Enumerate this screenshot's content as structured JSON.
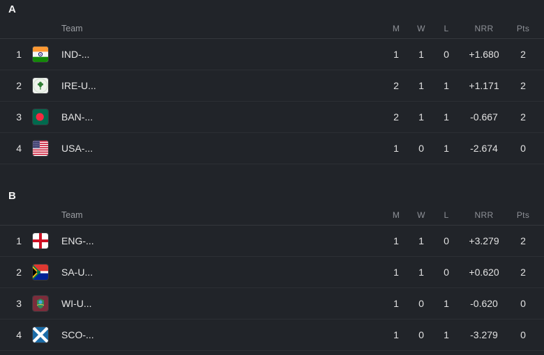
{
  "columns": {
    "team": "Team",
    "matches": "M",
    "wins": "W",
    "losses": "L",
    "nrr": "NRR",
    "points": "Pts"
  },
  "groups": [
    {
      "title": "A",
      "rows": [
        {
          "rank": "1",
          "flag": "india-flag-icon",
          "team": "IND-...",
          "m": "1",
          "w": "1",
          "l": "0",
          "nrr": "+1.680",
          "pts": "2"
        },
        {
          "rank": "2",
          "flag": "ireland-flag-icon",
          "team": "IRE-U...",
          "m": "2",
          "w": "1",
          "l": "1",
          "nrr": "+1.171",
          "pts": "2"
        },
        {
          "rank": "3",
          "flag": "bangladesh-flag-icon",
          "team": "BAN-...",
          "m": "2",
          "w": "1",
          "l": "1",
          "nrr": "-0.667",
          "pts": "2"
        },
        {
          "rank": "4",
          "flag": "usa-flag-icon",
          "team": "USA-...",
          "m": "1",
          "w": "0",
          "l": "1",
          "nrr": "-2.674",
          "pts": "0"
        }
      ]
    },
    {
      "title": "B",
      "rows": [
        {
          "rank": "1",
          "flag": "england-flag-icon",
          "team": "ENG-...",
          "m": "1",
          "w": "1",
          "l": "0",
          "nrr": "+3.279",
          "pts": "2"
        },
        {
          "rank": "2",
          "flag": "southafrica-flag-icon",
          "team": "SA-U...",
          "m": "1",
          "w": "1",
          "l": "0",
          "nrr": "+0.620",
          "pts": "2"
        },
        {
          "rank": "3",
          "flag": "westindies-flag-icon",
          "team": "WI-U...",
          "m": "1",
          "w": "0",
          "l": "1",
          "nrr": "-0.620",
          "pts": "0"
        },
        {
          "rank": "4",
          "flag": "scotland-flag-icon",
          "team": "SCO-...",
          "m": "1",
          "w": "0",
          "l": "1",
          "nrr": "-3.279",
          "pts": "0"
        }
      ]
    }
  ],
  "colors": {
    "background": "#212429",
    "row_separator": "#2c2f34",
    "header_text": "#8e9197",
    "body_text": "#e2e2e2"
  }
}
